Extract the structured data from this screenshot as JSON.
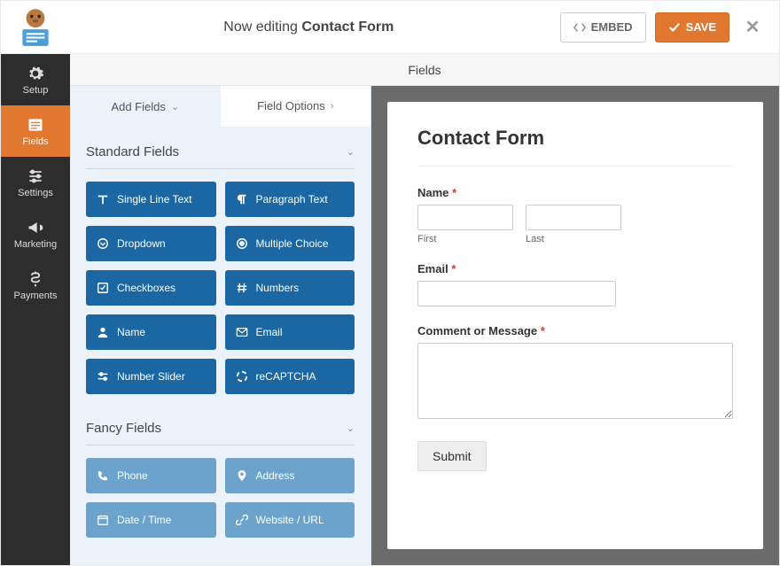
{
  "header": {
    "editing_prefix": "Now editing",
    "form_name": "Contact Form",
    "embed_label": "EMBED",
    "save_label": "SAVE"
  },
  "subheader": {
    "title": "Fields"
  },
  "sidebar": {
    "items": [
      {
        "label": "Setup"
      },
      {
        "label": "Fields"
      },
      {
        "label": "Settings"
      },
      {
        "label": "Marketing"
      },
      {
        "label": "Payments"
      }
    ]
  },
  "tabs": {
    "add_fields": "Add Fields",
    "field_options": "Field Options"
  },
  "sections": {
    "standard": {
      "title": "Standard Fields",
      "items": [
        {
          "label": "Single Line Text",
          "icon": "text"
        },
        {
          "label": "Paragraph Text",
          "icon": "paragraph"
        },
        {
          "label": "Dropdown",
          "icon": "dropdown"
        },
        {
          "label": "Multiple Choice",
          "icon": "radio"
        },
        {
          "label": "Checkboxes",
          "icon": "checkbox"
        },
        {
          "label": "Numbers",
          "icon": "hash"
        },
        {
          "label": "Name",
          "icon": "user"
        },
        {
          "label": "Email",
          "icon": "envelope"
        },
        {
          "label": "Number Slider",
          "icon": "slider"
        },
        {
          "label": "reCAPTCHA",
          "icon": "recaptcha"
        }
      ]
    },
    "fancy": {
      "title": "Fancy Fields",
      "items": [
        {
          "label": "Phone",
          "icon": "phone"
        },
        {
          "label": "Address",
          "icon": "pin"
        },
        {
          "label": "Date / Time",
          "icon": "calendar"
        },
        {
          "label": "Website / URL",
          "icon": "link"
        }
      ]
    }
  },
  "preview": {
    "title": "Contact Form",
    "name_label": "Name",
    "first_label": "First",
    "last_label": "Last",
    "email_label": "Email",
    "comment_label": "Comment or Message",
    "submit_label": "Submit",
    "required_marker": "*"
  }
}
